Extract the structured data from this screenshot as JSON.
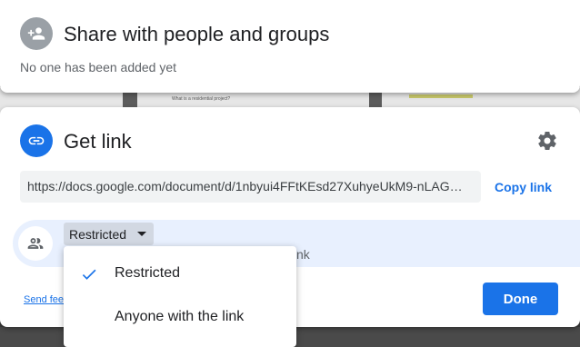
{
  "share_dialog": {
    "title": "Share with people and groups",
    "subtext": "No one has been added yet"
  },
  "link_dialog": {
    "title": "Get link",
    "url": "https://docs.google.com/document/d/1nbyui4FFtKEsd27XuhyeUkM9-nLAG…",
    "copy_label": "Copy link",
    "access": {
      "selected": "Restricted",
      "description_fragment": "nk"
    },
    "feedback_label": "Send feedback",
    "done_label": "Done"
  },
  "access_menu": {
    "options": [
      {
        "label": "Restricted",
        "checked": true
      },
      {
        "label": "Anyone with the link",
        "checked": false
      }
    ]
  },
  "background": {
    "doc_text": "What is a residential project?"
  },
  "icons": {
    "share": "person-add-icon",
    "link": "link-icon",
    "settings": "gear-icon",
    "people": "people-icon",
    "check": "check-icon"
  },
  "colors": {
    "accent": "#1a73e8",
    "highlight_row": "#e8f0fe",
    "url_bg": "#f1f3f4"
  }
}
